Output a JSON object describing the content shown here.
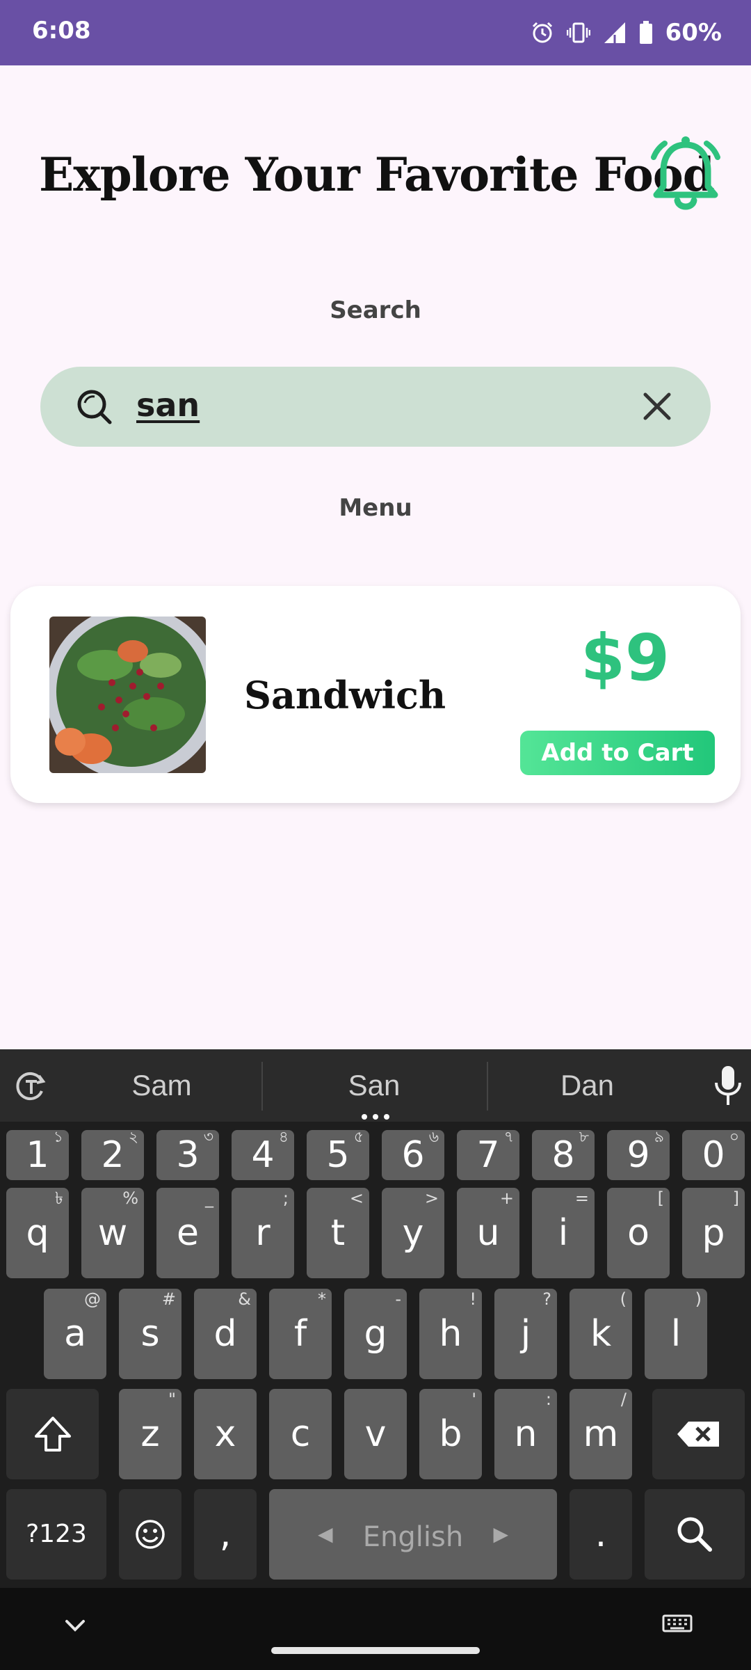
{
  "status_bar": {
    "time": "6:08",
    "battery": "60%"
  },
  "header": {
    "title": "Explore Your Favorite Food"
  },
  "labels": {
    "search": "Search",
    "menu": "Menu"
  },
  "search": {
    "value": "san"
  },
  "menu_items": [
    {
      "name": "Sandwich",
      "price": "$9",
      "button": "Add to Cart"
    }
  ],
  "keyboard": {
    "suggestions": [
      "Sam",
      "San",
      "Dan"
    ],
    "number_row": [
      {
        "k": "1",
        "h": "১"
      },
      {
        "k": "2",
        "h": "২"
      },
      {
        "k": "3",
        "h": "৩"
      },
      {
        "k": "4",
        "h": "৪"
      },
      {
        "k": "5",
        "h": "৫"
      },
      {
        "k": "6",
        "h": "৬"
      },
      {
        "k": "7",
        "h": "৭"
      },
      {
        "k": "8",
        "h": "৮"
      },
      {
        "k": "9",
        "h": "৯"
      },
      {
        "k": "0",
        "h": "০"
      }
    ],
    "row1": [
      {
        "k": "q",
        "h": "৳"
      },
      {
        "k": "w",
        "h": "%"
      },
      {
        "k": "e",
        "h": "_"
      },
      {
        "k": "r",
        "h": ";"
      },
      {
        "k": "t",
        "h": "<"
      },
      {
        "k": "y",
        "h": ">"
      },
      {
        "k": "u",
        "h": "+"
      },
      {
        "k": "i",
        "h": "="
      },
      {
        "k": "o",
        "h": "["
      },
      {
        "k": "p",
        "h": "]"
      }
    ],
    "row2": [
      {
        "k": "a",
        "h": "@"
      },
      {
        "k": "s",
        "h": "#"
      },
      {
        "k": "d",
        "h": "&"
      },
      {
        "k": "f",
        "h": "*"
      },
      {
        "k": "g",
        "h": "-"
      },
      {
        "k": "h",
        "h": "!"
      },
      {
        "k": "j",
        "h": "?"
      },
      {
        "k": "k",
        "h": "("
      },
      {
        "k": "l",
        "h": ")"
      }
    ],
    "row3": [
      {
        "k": "z",
        "h": "\""
      },
      {
        "k": "x",
        "h": ""
      },
      {
        "k": "c",
        "h": ""
      },
      {
        "k": "v",
        "h": ""
      },
      {
        "k": "b",
        "h": "'"
      },
      {
        "k": "n",
        "h": ":"
      },
      {
        "k": "m",
        "h": "/"
      }
    ],
    "symbols_key": "?123",
    "comma_key": ",",
    "space_label": "English",
    "period_key": "."
  },
  "colors": {
    "status_bar": "#6950a5",
    "accent_green": "#2ec27e",
    "search_bg": "#cde0d3",
    "page_bg": "#fdf5fc"
  }
}
